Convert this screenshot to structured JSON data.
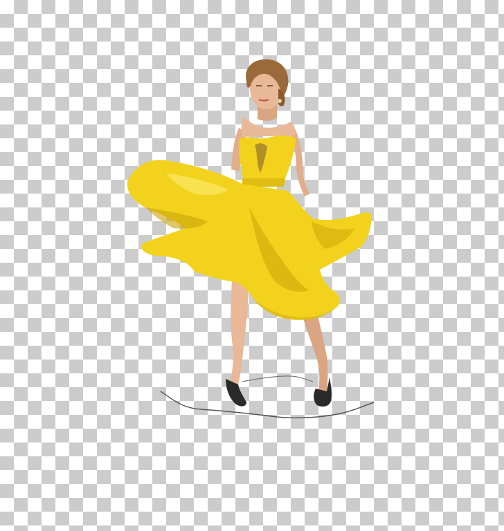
{
  "image": {
    "background_pattern": "transparency-checkerboard",
    "checker_colors": [
      "#ffffff",
      "#cccccc"
    ],
    "subject": "woman-in-yellow-dress",
    "colors": {
      "dress": "#f2d21c",
      "dress_shadow": "#c9a40a",
      "dress_highlight": "#fbe86a",
      "skin": "#e8b897",
      "skin_shadow": "#c98f6c",
      "hair": "#9a6a3a",
      "shoes": "#2a2a2a",
      "ground_line": "#555555"
    }
  }
}
